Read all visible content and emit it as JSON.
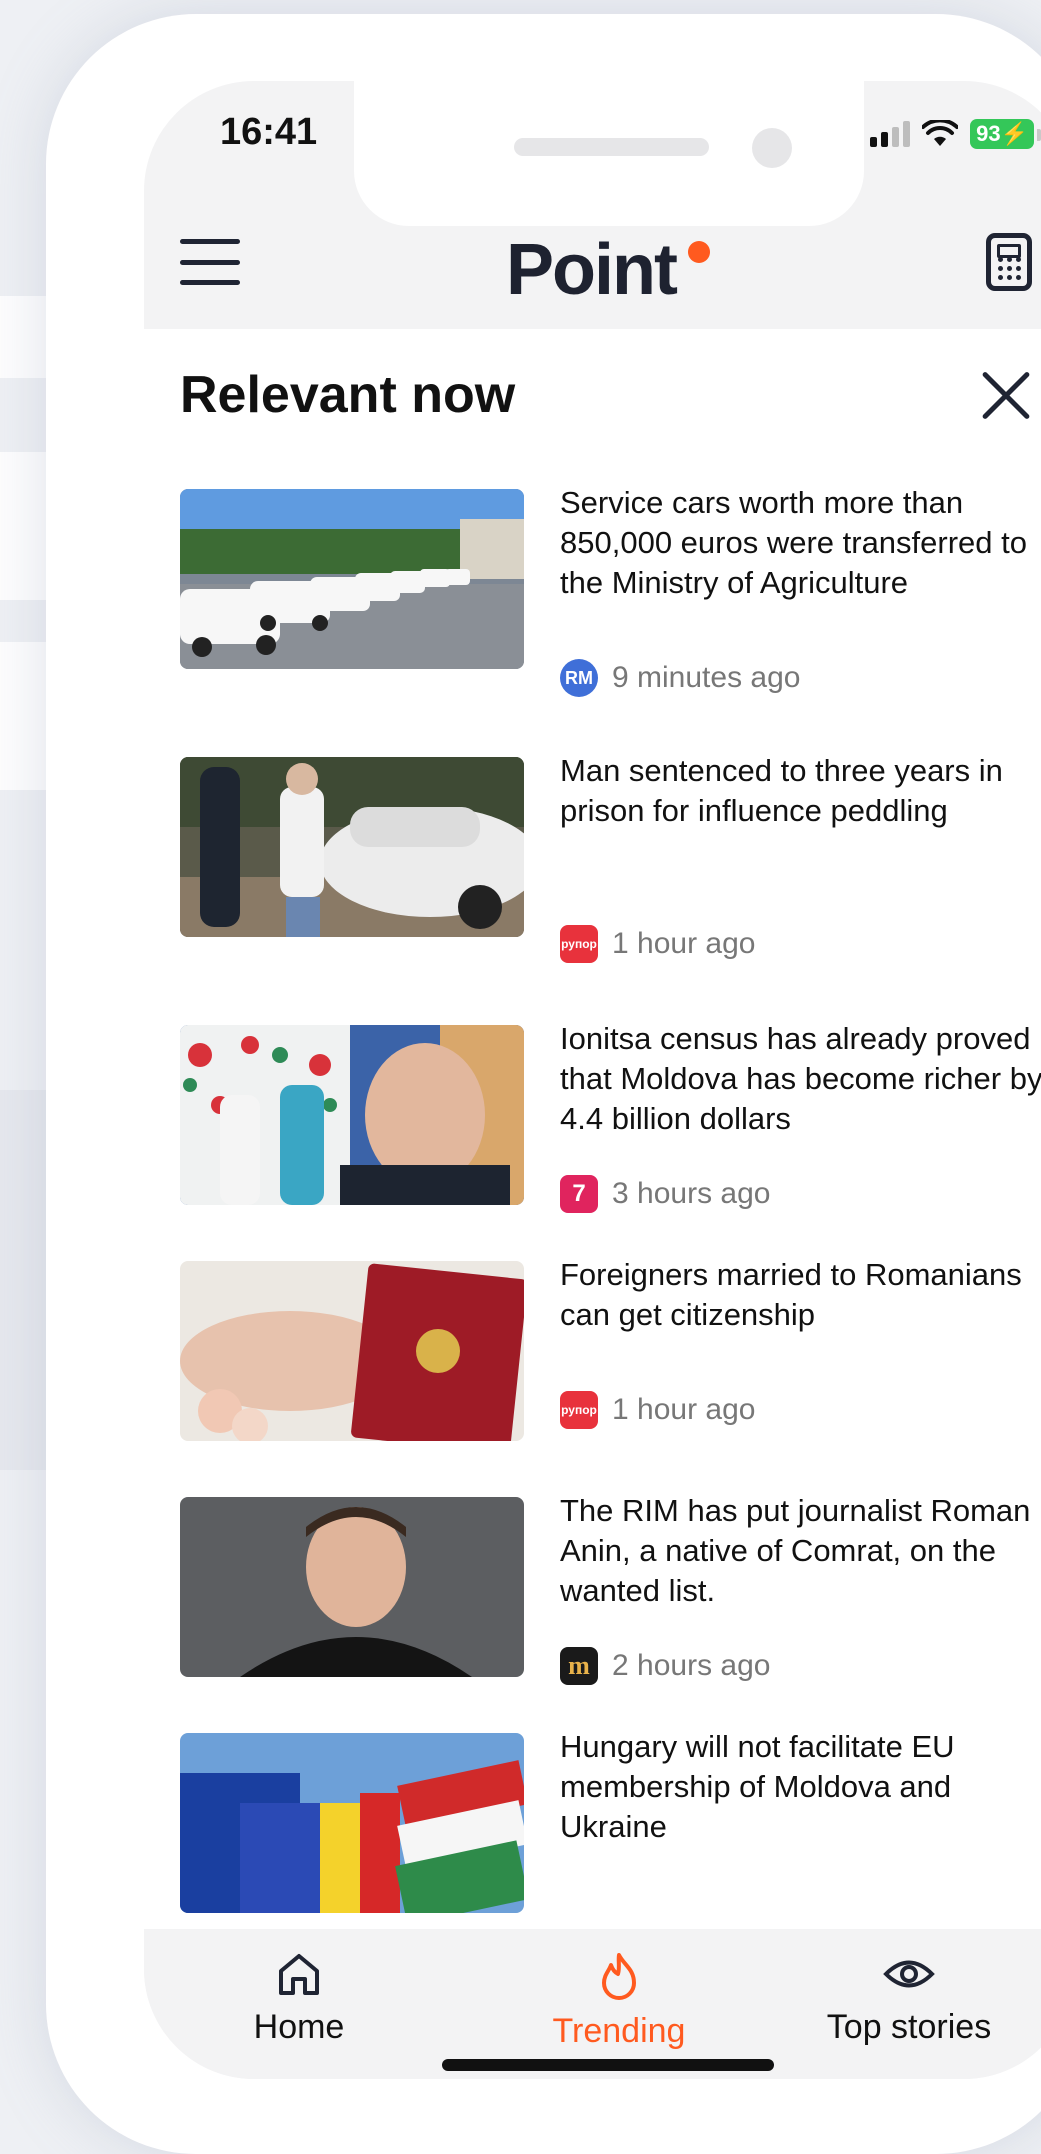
{
  "status_bar": {
    "time": "16:41",
    "battery": "93"
  },
  "header": {
    "logo": "Point",
    "accent_color": "#ff5a1f"
  },
  "section": {
    "title": "Relevant now"
  },
  "news": [
    {
      "title": "Service cars worth more than 850,000 euros were transferred to the Ministry of Agriculture",
      "time": "9 minutes ago",
      "source_icon": "rm-source-icon",
      "source_color": "#3f6fd8"
    },
    {
      "title": "Man sentenced to three years in prison for influence peddling",
      "time": "1 hour ago",
      "source_icon": "rupor-source-icon",
      "source_color": "#e8323c",
      "source_text": "рупор"
    },
    {
      "title": "Ionitsa census has already proved that Moldova has become richer by 4.4 billion dollars",
      "time": "3 hours ago",
      "source_icon": "seven-source-icon",
      "source_color": "#e0245e",
      "source_text": "7"
    },
    {
      "title": "Foreigners married to Romanians can get citizenship",
      "time": "1 hour ago",
      "source_icon": "rupor-source-icon",
      "source_color": "#e8323c",
      "source_text": "рупор"
    },
    {
      "title": "The RIM has put journalist Roman Anin, a native of Comrat, on the wanted list.",
      "time": "2 hours ago",
      "source_icon": "m-source-icon",
      "source_color": "#1a1a1a",
      "source_text": "m"
    },
    {
      "title": "Hungary will not facilitate EU membership of Moldova and Ukraine",
      "time": "",
      "source_icon": "",
      "source_color": ""
    }
  ],
  "bottom_nav": {
    "home": "Home",
    "trending": "Trending",
    "top_stories": "Top stories",
    "active": "trending"
  }
}
